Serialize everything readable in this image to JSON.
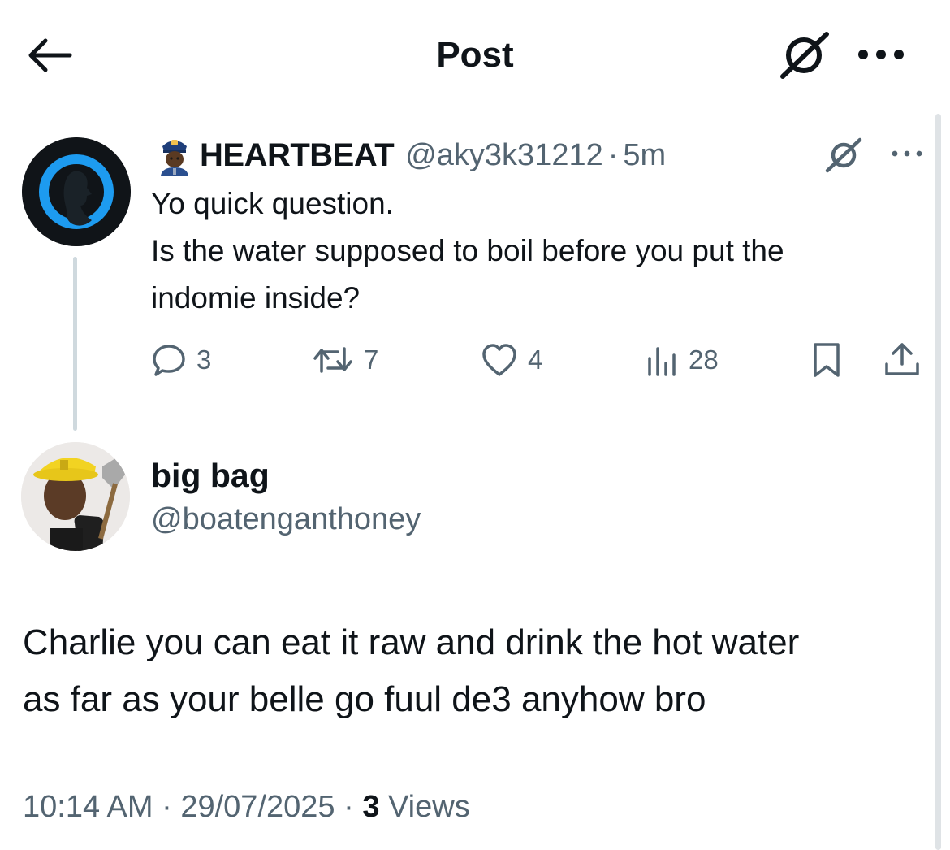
{
  "header": {
    "title": "Post"
  },
  "quoted": {
    "badge_emoji": "police-officer",
    "name": "HEARTBEAT",
    "handle": "@aky3k31212",
    "separator": "·",
    "time": "5m",
    "lines": [
      "Yo quick question.",
      "Is the water supposed to boil before you put the",
      "indomie inside?"
    ],
    "actions": {
      "replies": "3",
      "reposts": "7",
      "likes": "4",
      "views": "28"
    }
  },
  "post": {
    "name": "big bag",
    "handle": "@boatenganthoney",
    "lines": [
      "Charlie you can eat it raw and drink the hot water",
      "as far as your belle go fuul de3 anyhow bro"
    ],
    "time": "10:14 AM",
    "sep": "·",
    "date": "29/07/2025",
    "views_count": "3",
    "views_label": "Views"
  },
  "colors": {
    "text": "#0f1419",
    "muted": "#536471",
    "thread_line": "#cfd9de",
    "avatar_accent": "#1d9bf0"
  }
}
